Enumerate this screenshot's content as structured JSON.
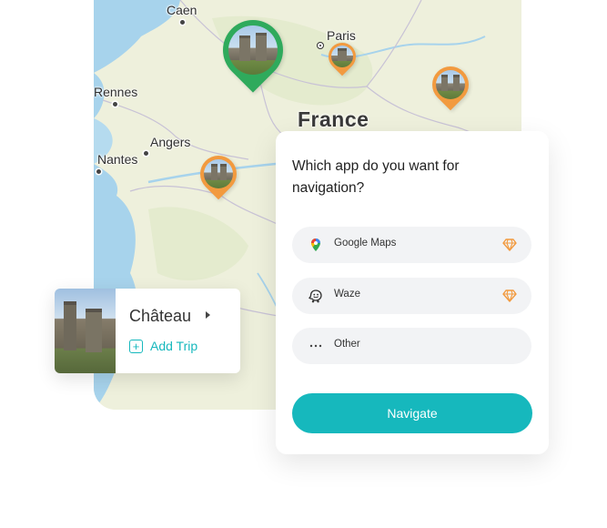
{
  "map": {
    "country_label": "France",
    "cities": [
      {
        "name": "Caen"
      },
      {
        "name": "Paris"
      },
      {
        "name": "Rennes"
      },
      {
        "name": "Angers"
      },
      {
        "name": "Nantes"
      }
    ],
    "pin_colors": {
      "selected": "#2faa5c",
      "default": "#f29a3f"
    }
  },
  "place_card": {
    "title": "Château",
    "add_trip_label": "Add Trip",
    "add_trip_icon": "plus-square-icon",
    "caret_icon": "caret-right-icon"
  },
  "nav_dialog": {
    "question": "Which app do you want for navigation?",
    "options": [
      {
        "label": "Google Maps",
        "icon": "google-maps-icon",
        "premium": true
      },
      {
        "label": "Waze",
        "icon": "waze-icon",
        "premium": true
      },
      {
        "label": "Other",
        "icon": "more-dots-icon",
        "premium": false
      }
    ],
    "premium_icon": "diamond-icon",
    "navigate_label": "Navigate"
  },
  "colors": {
    "accent": "#16b8bd",
    "premium": "#f29a3f"
  }
}
